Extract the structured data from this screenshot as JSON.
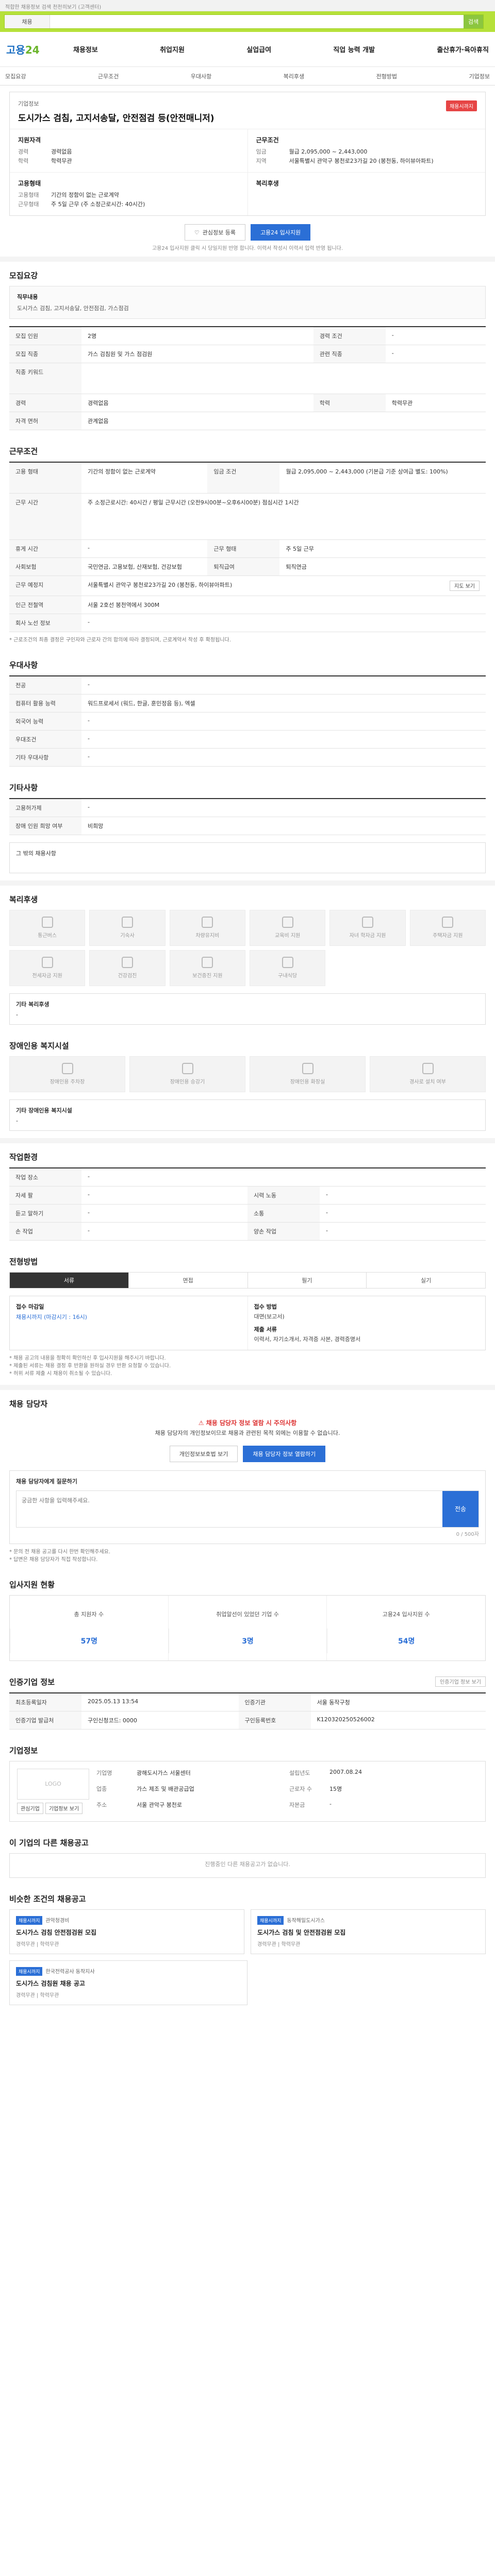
{
  "topbar": {
    "text": "적합한 채용정보 검색 천천히보기 (고객센터)"
  },
  "search": {
    "tab": "채용",
    "placeholder": "",
    "go": "검색"
  },
  "header": {
    "logo_a": "고용",
    "logo_b": "24",
    "gnb": [
      "채용정보",
      "취업지원",
      "실업급여",
      "직업 능력 개발",
      "출산휴가·육아휴직"
    ]
  },
  "subtabs": [
    "모집요강",
    "근무조건",
    "우대사항",
    "복리후생",
    "전형방법",
    "기업정보"
  ],
  "job": {
    "badge": "채용시까지",
    "company": "기업정보",
    "title": "도시가스 검침, 고지서송달, 안전점검 등(안전매니저)",
    "col1_head": "지원자격",
    "col2_head": "근무조건",
    "rows1": [
      {
        "k": "경력",
        "v": "경력없음"
      },
      {
        "k": "학력",
        "v": "학력무관"
      }
    ],
    "rows2": [
      {
        "k": "임금",
        "v": "월급 2,095,000 ~ 2,443,000"
      },
      {
        "k": "지역",
        "v": "서울특별시 관악구 봉천로23가길 20 (봉천동, 하이뷰아파트)"
      }
    ],
    "col3_head": "고용형태",
    "col4_head": "복리후생",
    "rows3": [
      {
        "k": "고용형태",
        "v": "기간의 정함이 없는 근로계약"
      },
      {
        "k": "근무형태",
        "v": "주 5일 근무 (주 소정근로시간: 40시간)"
      }
    ],
    "rows4": []
  },
  "actions": {
    "scrap": "관심정보 등록",
    "apply": "고용24 입사지원"
  },
  "action_note": "고용24 입사지원 클릭 시 당일지원 반영 합니다. 이력서 작성시 이력서 입력 반영 됩니다.",
  "recruit": {
    "title": "모집요강",
    "box_title": "직무내용",
    "box_text": "도시가스 검침, 고지서송달, 안전점검, 가스점검",
    "rows": [
      {
        "k": "모집 인원",
        "v": "2명",
        "k2": "경력 조건",
        "v2": "-"
      },
      {
        "k": "모집 직종",
        "v": "가스 검침원 및 가스 점검원",
        "k2": "관련 직종",
        "v2": "-"
      },
      {
        "k": "직종 키워드",
        "v": "",
        "k2": "",
        "v2": ""
      },
      {
        "k": "경력",
        "v": "경력없음",
        "k2": "학력",
        "v2": "학력무관"
      },
      {
        "k": "자격 면허",
        "v": "관계없음",
        "k2": "",
        "v2": ""
      }
    ]
  },
  "work": {
    "title": "근무조건",
    "rows": [
      {
        "k": "고용 형태",
        "v": "기간의 정함이 없는 근로계약",
        "k2": "임금 조건",
        "v2": "월급 2,095,000 ~ 2,443,000 (기본급 기준 상여급 별도: 100%)"
      },
      {
        "k": "근무 시간",
        "v": "주 소정근로시간: 40시간 / 평일 근무시간 (오전9시00분~오후6시00분) 점심시간 1시간",
        "k2": "",
        "v2": ""
      },
      {
        "k": "휴게 시간",
        "v": "-",
        "k2": "근무 형태",
        "v2": "주 5일 근무"
      },
      {
        "k": "사회보험",
        "v": "국민연금, 고용보험, 산재보험, 건강보험",
        "k2": "퇴직급여",
        "v2": "퇴직연금"
      },
      {
        "k": "근무 예정지",
        "v": "서울특별시 관악구 봉천로23가길 20 (봉천동, 하이뷰아파트)",
        "k2": "",
        "v2": ""
      },
      {
        "k": "인근 전철역",
        "v": "서울 2호선 봉천역에서 300M",
        "k2": "",
        "v2": ""
      },
      {
        "k": "회사 노선 정보",
        "v": "-",
        "k2": "",
        "v2": ""
      }
    ],
    "note": "* 근로조건의 최종 결정은 구인자와 근로자 간의 합의에 따라 결정되며, 근로계약서 작성 후 확정됩니다.",
    "map_btn": "지도 보기"
  },
  "prefer": {
    "title": "우대사항",
    "rows": [
      {
        "k": "전공",
        "v": "-"
      },
      {
        "k": "컴퓨터 활용 능력",
        "v": "워드프로세서 (워드, 한글, 훈민정음 등), 엑셀"
      },
      {
        "k": "외국어 능력",
        "v": "-"
      },
      {
        "k": "우대조건",
        "v": "-"
      },
      {
        "k": "기타 우대사항",
        "v": "-"
      }
    ]
  },
  "etc": {
    "title": "기타사항",
    "rows": [
      {
        "k": "고용허가제",
        "v": "-"
      },
      {
        "k": "장애 인원 희망 여부",
        "v": "비희망"
      }
    ],
    "box": "그 밖의 채용사항"
  },
  "welfare": {
    "title": "복리후생",
    "icons_row1": [
      "통근버스",
      "기숙사",
      "차량유지비",
      "교육비 지원",
      "자녀 학자금 지원",
      "주택자금 지원"
    ],
    "icons_row2": [
      "전세자금 지원",
      "건강검진",
      "보건증진 지원",
      "구내식당"
    ],
    "other_head": "기타 복리후생",
    "other_val": "-"
  },
  "disabled": {
    "title": "장애인용 복지시설",
    "icons": [
      "장애인용 주차장",
      "장애인용 승강기",
      "장애인용 화장실",
      "경사로 설치 여부"
    ],
    "other_head": "기타 장애인용 복지시설",
    "other_val": "-"
  },
  "env": {
    "title": "작업환경",
    "rows": [
      {
        "k": "작업 장소",
        "v": "-",
        "k2": "",
        "v2": ""
      },
      {
        "k": "자세 팔",
        "v": "-",
        "k2": "시력 노동",
        "v2": "-"
      },
      {
        "k": "듣고 말하기",
        "v": "-",
        "k2": "소통",
        "v2": "-"
      },
      {
        "k": "손 작업",
        "v": "-",
        "k2": "양손 작업",
        "v2": "-"
      }
    ]
  },
  "process": {
    "title": "전형방법",
    "transit": [
      "서류",
      "면접",
      "필기",
      "실기"
    ],
    "apply_head": "접수 마감일",
    "apply_val": "채용시까지 (마감시기 : 16시)",
    "method_head": "접수 방법",
    "method_val": "대면(보고서)",
    "doc_head": "제출 서류",
    "doc_val": "이력서, 자기소개서, 자격증 사본, 경력증명서",
    "list": [
      "* 채용 공고의 내용을 정확히 확인하신 후 입사지원을 해주시기 바랍니다.",
      "* 제출된 서류는 채용 결정 후 반환을 원하실 경우 반환 요청할 수 있습니다.",
      "* 허위 서류 제출 시 채용이 취소될 수 있습니다."
    ]
  },
  "counselor": {
    "title": "채용 담당자",
    "t1": "채용 담당자 정보 열람 시 주의사항",
    "t2": "채용 담당자의 개인정보이므로 채용과 관련된 목적 외에는 이용할 수 없습니다.",
    "btn1": "개인정보보호법 보기",
    "btn2": "채용 담당자 정보 열람하기",
    "inq_head": "채용 담당자에게 질문하기",
    "inq_ph": "궁금한 사항을 입력해주세요.",
    "inq_count": "0 / 500자",
    "send": "전송",
    "list": [
      "* 문의 전 채용 공고를 다시 한번 확인해주세요.",
      "* 답변은 채용 담당자가 직접 작성합니다."
    ]
  },
  "stats": {
    "title": "입사지원 현황",
    "items": [
      {
        "lab": "총 지원자 수",
        "num": "57명"
      },
      {
        "lab": "취업알선이 있었던 기업 수",
        "num": "3명"
      },
      {
        "lab": "고용24 입사지원 수",
        "num": "54명"
      }
    ]
  },
  "info": {
    "title": "인증기업 정보",
    "btn": "인증기업 정보 보기",
    "rows": [
      {
        "k": "최초등록일자",
        "v": "2025.05.13 13:54",
        "k2": "인증기관",
        "v2": "서울 동작구청"
      },
      {
        "k": "인증기업 발급처",
        "v": "구인신청코드: 0000",
        "k2": "구인등록번호",
        "v2": "K120320250526002"
      }
    ]
  },
  "corp": {
    "title": "기업정보",
    "logo_ph": "LOGO",
    "btn1": "관심기업",
    "btn2": "기업정보 보기",
    "grid": [
      {
        "k": "기업명",
        "v": "광해도시가스 서울센터"
      },
      {
        "k": "업종",
        "v": "가스 제조 및 배관공급업"
      },
      {
        "k": "주소",
        "v": "서울 관악구 봉천로"
      },
      {
        "k": "설립년도",
        "v": "2007.08.24"
      },
      {
        "k": "근로자 수",
        "v": "15명"
      },
      {
        "k": "자본금",
        "v": "-"
      }
    ]
  },
  "similar": {
    "title": "이 기업의 다른 채용공고",
    "empty": "진행중인 다른 채용공고가 없습니다.",
    "title2": "비슷한 조건의 채용공고",
    "cards": [
      {
        "tag": "채용시까지",
        "co": "관악청경비",
        "ti": "도시가스 검침 안전점검원 모집",
        "meta": "경력무관 | 학력무관"
      },
      {
        "tag": "채용시까지",
        "co": "동작해밀도시가스",
        "ti": "도시가스 검침 및 안전점검원 모집",
        "meta": "경력무관 | 학력무관"
      },
      {
        "tag": "채용시까지",
        "co": "한국전력공사 동작지사",
        "ti": "도시가스 검침원 채용 공고",
        "meta": "경력무관 | 학력무관"
      }
    ]
  }
}
